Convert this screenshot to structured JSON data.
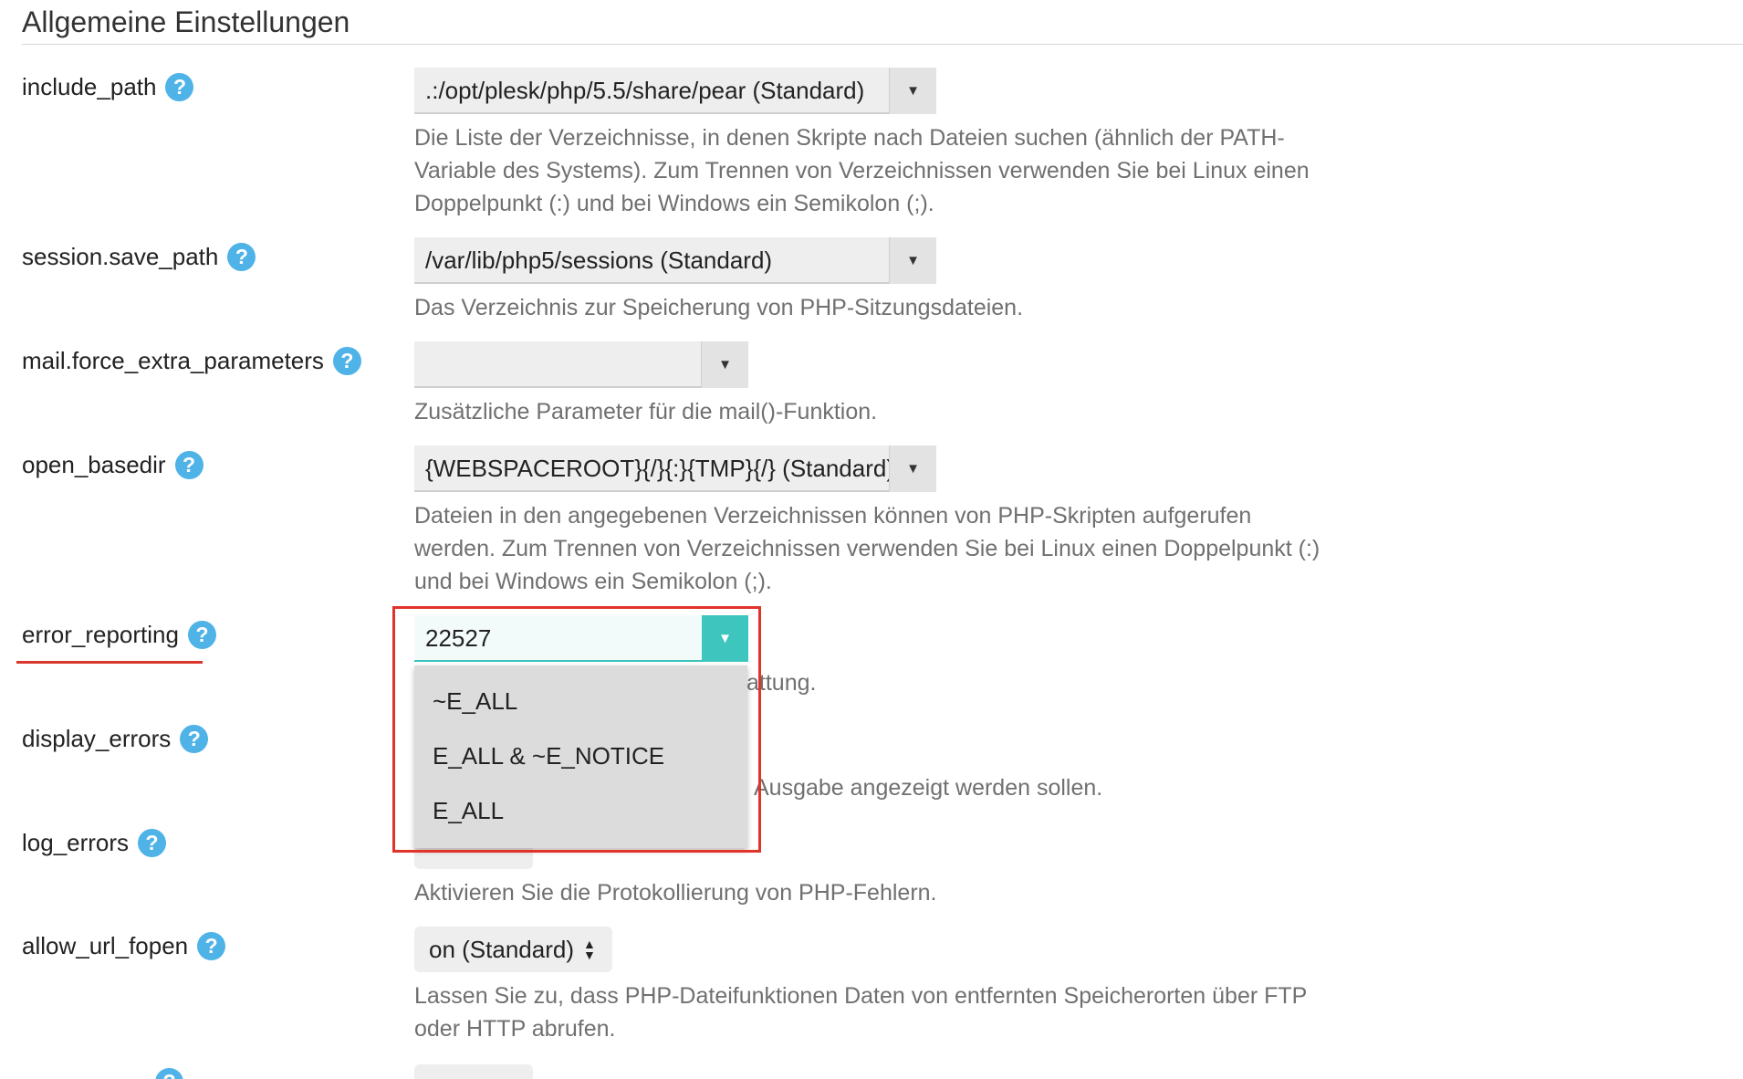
{
  "section": {
    "title": "Allgemeine Einstellungen"
  },
  "icons": {
    "help_glyph": "?"
  },
  "settings": {
    "include_path": {
      "label": "include_path",
      "value": ".:/opt/plesk/php/5.5/share/pear (Standard)",
      "description": "Die Liste der Verzeichnisse, in denen Skripte nach Dateien suchen (ähnlich der PATH-Variable des Systems). Zum Trennen von Verzeichnissen verwenden Sie bei Linux einen Doppelpunkt (:) und bei Windows ein Semikolon (;)."
    },
    "session_save_path": {
      "label": "session.save_path",
      "value": "/var/lib/php5/sessions (Standard)",
      "description": "Das Verzeichnis zur Speicherung von PHP-Sitzungsdateien."
    },
    "mail_force_extra_parameters": {
      "label": "mail.force_extra_parameters",
      "value": "",
      "description": "Zusätzliche Parameter für die mail()-Funktion."
    },
    "open_basedir": {
      "label": "open_basedir",
      "value": "{WEBSPACEROOT}{/}{:}{TMP}{/} (Standard)",
      "description": "Dateien in den angegebenen Verzeichnissen können von PHP-Skripten aufgerufen werden. Zum Trennen von Verzeichnissen verwenden Sie bei Linux einen Doppelpunkt (:) und bei Windows ein Semikolon (;)."
    },
    "error_reporting": {
      "label": "error_reporting",
      "value": "22527",
      "description_tail": "attung.",
      "options": [
        "~E_ALL",
        "E_ALL & ~E_NOTICE",
        "E_ALL"
      ]
    },
    "display_errors": {
      "label": "display_errors",
      "description_tail": "Ausgabe angezeigt werden sollen."
    },
    "log_errors": {
      "label": "log_errors",
      "description": "Aktivieren Sie die Protokollierung von PHP-Fehlern."
    },
    "allow_url_fopen": {
      "label": "allow_url_fopen",
      "value": "on (Standard)",
      "description": "Lassen Sie zu, dass PHP-Dateifunktionen Daten von entfernten Speicherorten über FTP oder HTTP abrufen."
    }
  },
  "colors": {
    "accent_teal": "#3ec5bd",
    "help_blue": "#4fb3e8",
    "highlight_red": "#e0332a"
  }
}
